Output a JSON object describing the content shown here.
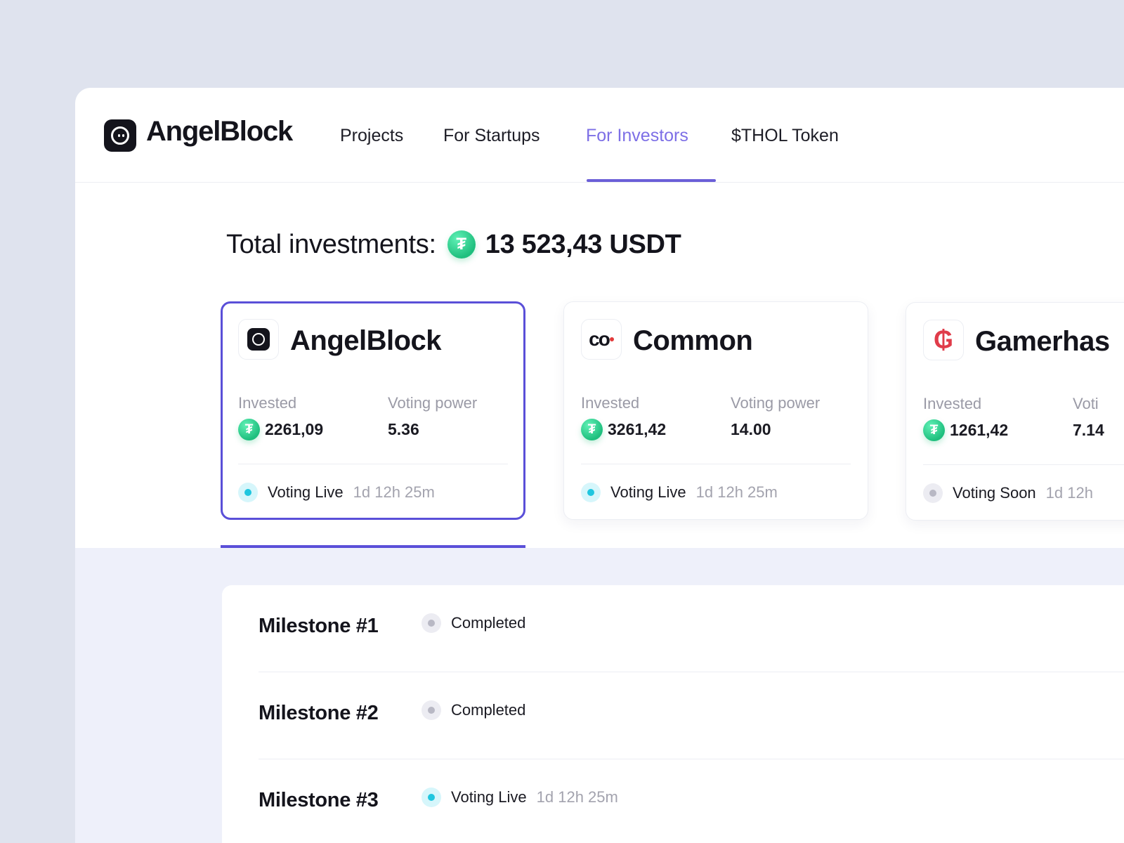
{
  "brand": {
    "name": "AngelBlock"
  },
  "nav": [
    {
      "label": "Projects",
      "active": false
    },
    {
      "label": "For Startups",
      "active": false
    },
    {
      "label": "For Investors",
      "active": true
    },
    {
      "label": "$THOL Token",
      "active": false
    }
  ],
  "total": {
    "label": "Total investments:",
    "currency_icon": "tether-usdt-icon",
    "value": "13 523,43 USDT"
  },
  "cards": [
    {
      "name": "AngelBlock",
      "invested_label": "Invested",
      "invested": "2261,09",
      "voting_label": "Voting power",
      "voting_power": "5.36",
      "status": "Voting Live",
      "time": "1d 12h 25m",
      "selected": true
    },
    {
      "name": "Common",
      "invested_label": "Invested",
      "invested": "3261,42",
      "voting_label": "Voting power",
      "voting_power": "14.00",
      "status": "Voting Live",
      "time": "1d 12h 25m",
      "selected": false
    },
    {
      "name": "Gamerhas",
      "invested_label": "Invested",
      "invested": "1261,42",
      "voting_label": "Voti",
      "voting_power": "7.14",
      "status": "Voting Soon",
      "time": "1d 12h",
      "selected": false
    }
  ],
  "milestones": [
    {
      "name": "Milestone #1",
      "status": "Completed",
      "time": ""
    },
    {
      "name": "Milestone #2",
      "status": "Completed",
      "time": ""
    },
    {
      "name": "Milestone #3",
      "status": "Voting Live",
      "time": "1d 12h 25m"
    }
  ],
  "colors": {
    "accent": "#5a4fd8",
    "nav_active": "#7d6fe6",
    "usdt": "#26c281",
    "live": "#1fc6df",
    "muted": "#9a9aa6"
  }
}
